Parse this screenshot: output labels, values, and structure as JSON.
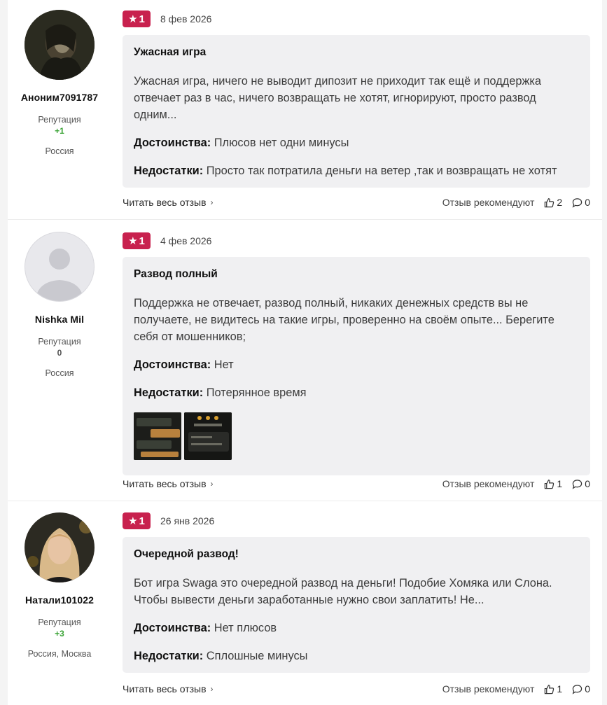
{
  "reviews": [
    {
      "author": "Аноним7091787",
      "rep_label": "Репутация",
      "rep_value": "+1",
      "location": "Россия",
      "rating": "1",
      "date": "8 фев 2026",
      "title": "Ужасная игра",
      "text": "Ужасная игра, ничего не выводит дипозит не приходит так ещё и поддержка отвечает раз в час, ничего возвращать не хотят, игнорируют, просто развод одним...",
      "pros_label": "Достоинства:",
      "pros": "Плюсов нет одни минусы",
      "cons_label": "Недостатки:",
      "cons": "Просто так потратила деньги на ветер ,так и возвращать не хотят",
      "read_more": "Читать весь отзыв",
      "recommend_label": "Отзыв рекомендуют",
      "likes": "2",
      "comments": "0"
    },
    {
      "author": "Nishka Mil",
      "rep_label": "Репутация",
      "rep_value": "0",
      "location": "Россия",
      "rating": "1",
      "date": "4 фев 2026",
      "title": "Развод полный",
      "text": "Поддержка не отвечает, развод полный, никаких денежных средств вы не получаете, не видитесь на такие игры, проверенно на своём опыте... Берегите себя от мошенников;",
      "pros_label": "Достоинства:",
      "pros": "Нет",
      "cons_label": "Недостатки:",
      "cons": "Потерянное время",
      "read_more": "Читать весь отзыв",
      "recommend_label": "Отзыв рекомендуют",
      "likes": "1",
      "comments": "0"
    },
    {
      "author": "Натали101022",
      "rep_label": "Репутация",
      "rep_value": "+3",
      "location": "Россия, Москва",
      "rating": "1",
      "date": "26 янв 2026",
      "title": "Очередной развод!",
      "text": "Бот игра Swaga это очередной развод на деньги! Подобие Хомяка или Слона. Чтобы вывести деньги заработанные нужно свои заплатить! Не...",
      "pros_label": "Достоинства:",
      "pros": "Нет плюсов",
      "cons_label": "Недостатки:",
      "cons": "Сплошные минусы",
      "read_more": "Читать весь отзыв",
      "recommend_label": "Отзыв рекомендуют",
      "likes": "1",
      "comments": "0"
    }
  ],
  "icons": {
    "star": "star-icon",
    "chevron": "chevron-right-icon",
    "like": "thumbs-up-icon",
    "comment": "comment-icon"
  },
  "colors": {
    "badge": "#c8214e",
    "positive_rep": "#3aa335",
    "card_bg": "#f0f0f2"
  }
}
